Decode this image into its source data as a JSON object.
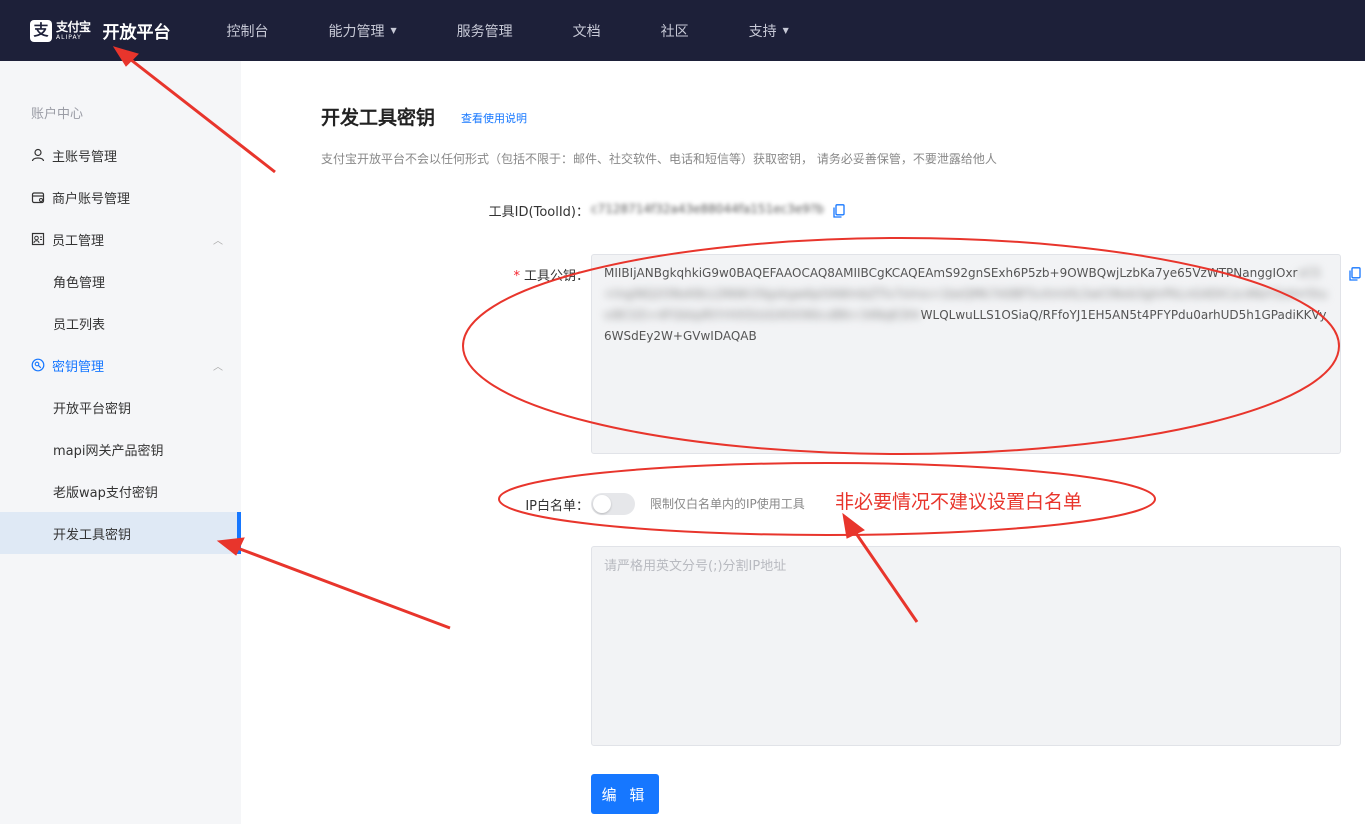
{
  "header": {
    "logo_glyph": "支",
    "logo_cn": "支付宝",
    "logo_en": "ALIPAY",
    "platform": "开放平台",
    "nav": [
      {
        "label": "控制台",
        "has_dropdown": false
      },
      {
        "label": "能力管理",
        "has_dropdown": true
      },
      {
        "label": "服务管理",
        "has_dropdown": false
      },
      {
        "label": "文档",
        "has_dropdown": false
      },
      {
        "label": "社区",
        "has_dropdown": false
      },
      {
        "label": "支持",
        "has_dropdown": true
      }
    ]
  },
  "sidebar": {
    "title": "账户中心",
    "items": [
      {
        "label": "主账号管理",
        "icon": "user-icon"
      },
      {
        "label": "商户账号管理",
        "icon": "shop-icon"
      },
      {
        "label": "员工管理",
        "icon": "staff-icon",
        "expanded": true
      },
      {
        "label": "角色管理"
      },
      {
        "label": "员工列表"
      },
      {
        "label": "密钥管理",
        "icon": "key-icon",
        "expanded": true,
        "active": true
      },
      {
        "label": "开放平台密钥"
      },
      {
        "label": "mapi网关产品密钥"
      },
      {
        "label": "老版wap支付密钥"
      },
      {
        "label": "开发工具密钥",
        "selected": true
      }
    ]
  },
  "main": {
    "title": "开发工具密钥",
    "help_link": "查看使用说明",
    "description": "支付宝开放平台不会以任何形式（包括不限于：邮件、社交软件、电话和短信等）获取密钥， 请务必妥善保管，不要泄露给他人",
    "toolid_label": "工具ID(ToolId)：",
    "toolid_value": "c7128714f32a43e88044fa151ec3e9?b",
    "pubkey_label": "工具公钥：",
    "pubkey_required": "*",
    "pubkey_visible_1": "MIIBIjANBgkqhkiG9w0BAQEFAAOCAQ8AMIIBCgKCAQEAmS92gnSExh6P5zb+9OWBQwjLzbKa7ye65VzWTPNanggIOxr",
    "pubkey_blurred": "vC5+lngiNQ2ONxK8cLDNWr29gxkgw6pOAWmbZTlv7sVvs+1beQMk7A0BF5vXmVtL5wCtNxb3ghrPkLnG4DtCzc4NzY2ohrr5tuvi8CG5+4FGkkpRtYrHXSVzGXOO90cvBN+34NqK3Hr",
    "pubkey_visible_2": "WLQLwuLLS1OSiaQ/RFfoYJ1EH5AN5t4PFYPdu0arhUD5h1GPadiKKVy6WSdEy2W+GVwIDAQAB",
    "ip_label": "IP白名单：",
    "ip_switch_on": false,
    "ip_switch_desc": "限制仅白名单内的IP使用工具",
    "warning_note": "非必要情况不建议设置白名单",
    "ip_placeholder": "请严格用英文分号(;)分割IP地址",
    "edit_button": "编 辑"
  },
  "colors": {
    "topbar": "#1d2039",
    "primary": "#1677ff",
    "annotation": "#e8352c",
    "sidebar_bg": "#f5f6f8"
  }
}
